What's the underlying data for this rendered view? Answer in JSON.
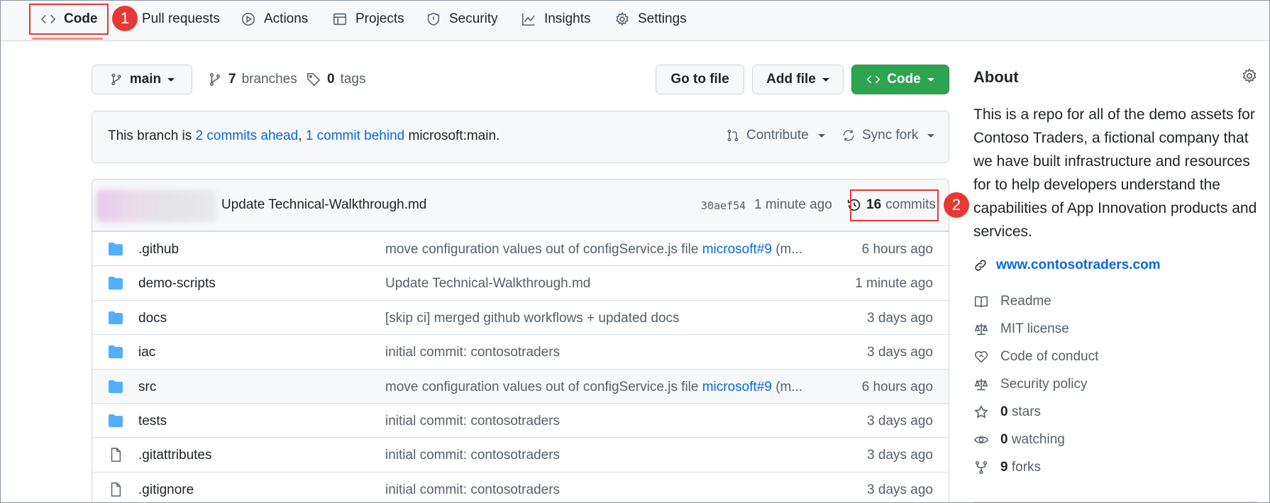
{
  "nav": {
    "tabs": [
      {
        "label": "Code",
        "icon": "code-icon"
      },
      {
        "label": "Pull requests",
        "icon": "pull-request-icon"
      },
      {
        "label": "Actions",
        "icon": "play-icon"
      },
      {
        "label": "Projects",
        "icon": "table-icon"
      },
      {
        "label": "Security",
        "icon": "shield-icon"
      },
      {
        "label": "Insights",
        "icon": "graph-icon"
      },
      {
        "label": "Settings",
        "icon": "gear-icon"
      }
    ]
  },
  "callouts": {
    "one": "1",
    "two": "2"
  },
  "toolbar": {
    "branch": "main",
    "branches_count": "7",
    "branches_label": "branches",
    "tags_count": "0",
    "tags_label": "tags",
    "go_to_file": "Go to file",
    "add_file": "Add file",
    "code": "Code"
  },
  "branch_status": {
    "prefix": "This branch is",
    "ahead": "2 commits ahead",
    "sep": ",",
    "behind": "1 commit behind",
    "suffix": "microsoft:main.",
    "contribute": "Contribute",
    "sync_fork": "Sync fork"
  },
  "latest_commit": {
    "message": "Update Technical-Walkthrough.md",
    "sha": "30aef54",
    "age": "1 minute ago",
    "commits_count": "16",
    "commits_label": "commits"
  },
  "files": [
    {
      "name": ".github",
      "type": "folder",
      "message": "move configuration values out of configService.js file ",
      "link": "microsoft#9",
      "tail": " (m...",
      "age": "6 hours ago"
    },
    {
      "name": "demo-scripts",
      "type": "folder",
      "message": "Update Technical-Walkthrough.md",
      "link": "",
      "tail": "",
      "age": "1 minute ago"
    },
    {
      "name": "docs",
      "type": "folder",
      "message": "[skip ci] merged github workflows + updated docs",
      "link": "",
      "tail": "",
      "age": "3 days ago"
    },
    {
      "name": "iac",
      "type": "folder",
      "message": "initial commit: contosotraders",
      "link": "",
      "tail": "",
      "age": "3 days ago"
    },
    {
      "name": "src",
      "type": "folder",
      "message": "move configuration values out of configService.js file ",
      "link": "microsoft#9",
      "tail": " (m...",
      "age": "6 hours ago"
    },
    {
      "name": "tests",
      "type": "folder",
      "message": "initial commit: contosotraders",
      "link": "",
      "tail": "",
      "age": "3 days ago"
    },
    {
      "name": ".gitattributes",
      "type": "file",
      "message": "initial commit: contosotraders",
      "link": "",
      "tail": "",
      "age": "3 days ago"
    },
    {
      "name": ".gitignore",
      "type": "file",
      "message": "initial commit: contosotraders",
      "link": "",
      "tail": "",
      "age": "3 days ago"
    }
  ],
  "about": {
    "title": "About",
    "description": "This is a repo for all of the demo assets for Contoso Traders, a fictional company that we have built infrastructure and resources for to help developers understand the capabilities of App Innovation products and services.",
    "website": "www.contosotraders.com",
    "readme": "Readme",
    "license": "MIT license",
    "conduct": "Code of conduct",
    "security": "Security policy",
    "stars_count": "0",
    "stars_label": "stars",
    "watching_count": "0",
    "watching_label": "watching",
    "forks_count": "9",
    "forks_label": "forks"
  },
  "colors": {
    "accent_link": "#0969da",
    "green_button": "#2da44e",
    "folder": "#54aeff",
    "callout": "#e53935",
    "nav_underline": "#fd8c73"
  }
}
